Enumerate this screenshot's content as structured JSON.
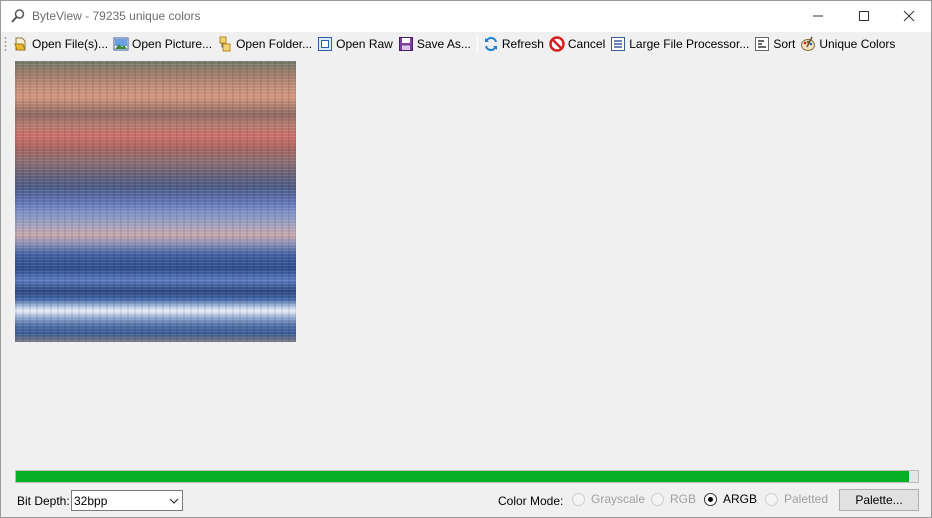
{
  "window": {
    "title": "ByteView - 79235 unique colors"
  },
  "toolbar": {
    "items": [
      {
        "label": "Open File(s)...",
        "icon": "open-file-icon"
      },
      {
        "label": "Open Picture...",
        "icon": "picture-icon"
      },
      {
        "label": "Open Folder...",
        "icon": "folder-icon"
      },
      {
        "label": "Open Raw",
        "icon": "raw-icon"
      },
      {
        "label": "Save As...",
        "icon": "save-icon"
      },
      {
        "label": "Refresh",
        "icon": "refresh-icon"
      },
      {
        "label": "Cancel",
        "icon": "cancel-icon"
      },
      {
        "label": "Large File Processor...",
        "icon": "list-icon"
      },
      {
        "label": "Sort",
        "icon": "sort-icon"
      },
      {
        "label": "Unique Colors",
        "icon": "palette-icon"
      }
    ]
  },
  "progress": {
    "value": 0.99,
    "color": "#06b025"
  },
  "bottom": {
    "bit_depth_label": "Bit Depth:",
    "bit_depth_value": "32bpp",
    "color_mode_label": "Color Mode:",
    "modes": [
      {
        "label": "Grayscale",
        "enabled": false,
        "checked": false
      },
      {
        "label": "RGB",
        "enabled": false,
        "checked": false
      },
      {
        "label": "ARGB",
        "enabled": true,
        "checked": true
      },
      {
        "label": "Paletted",
        "enabled": false,
        "checked": false
      }
    ],
    "palette_button": "Palette..."
  }
}
